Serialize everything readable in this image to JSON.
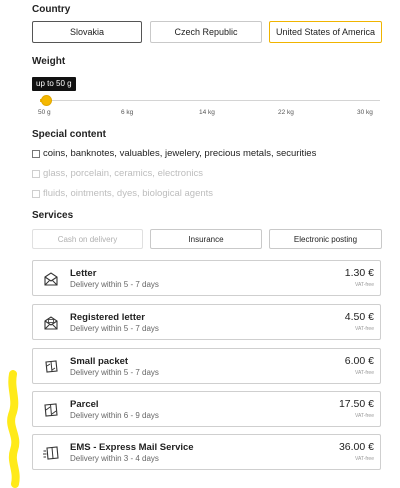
{
  "country": {
    "title": "Country",
    "options": [
      "Slovakia",
      "Czech Republic",
      "United States of America"
    ],
    "selected": "United States of America"
  },
  "weight": {
    "title": "Weight",
    "tooltip": "up to 50 g",
    "ticks": [
      "50 g",
      "6 kg",
      "14 kg",
      "22 kg",
      "30 kg"
    ],
    "value_fraction": 0.0
  },
  "special_content": {
    "title": "Special content",
    "items": [
      {
        "label": "coins, banknotes, valuables, jewelery, precious metals, securities",
        "enabled": true,
        "checked": false
      },
      {
        "label": "glass, porcelain, ceramics, electronics",
        "enabled": false,
        "checked": false
      },
      {
        "label": "fluids, ointments, dyes, biological agents",
        "enabled": false,
        "checked": false
      }
    ]
  },
  "services": {
    "title": "Services",
    "buttons": [
      {
        "label": "Cash on delivery",
        "enabled": false
      },
      {
        "label": "Insurance",
        "enabled": true
      },
      {
        "label": "Electronic posting",
        "enabled": true
      }
    ]
  },
  "results": [
    {
      "title": "Letter",
      "delivery": "Delivery within 5 - 7 days",
      "price": "1.30 €",
      "vat": "VAT-free",
      "icon": "letter-icon"
    },
    {
      "title": "Registered letter",
      "delivery": "Delivery within 5 - 7 days",
      "price": "4.50 €",
      "vat": "VAT-free",
      "icon": "registered-letter-icon"
    },
    {
      "title": "Small packet",
      "delivery": "Delivery within 5 - 7 days",
      "price": "6.00 €",
      "vat": "VAT-free",
      "icon": "small-packet-icon"
    },
    {
      "title": "Parcel",
      "delivery": "Delivery within 6 - 9 days",
      "price": "17.50 €",
      "vat": "VAT-free",
      "icon": "parcel-icon"
    },
    {
      "title": "EMS - Express Mail Service",
      "delivery": "Delivery within 3 - 4 days",
      "price": "36.00 €",
      "vat": "VAT-free",
      "icon": "express-parcel-icon"
    }
  ],
  "colors": {
    "accent": "#f0b400",
    "highlighter": "#ffe800"
  }
}
